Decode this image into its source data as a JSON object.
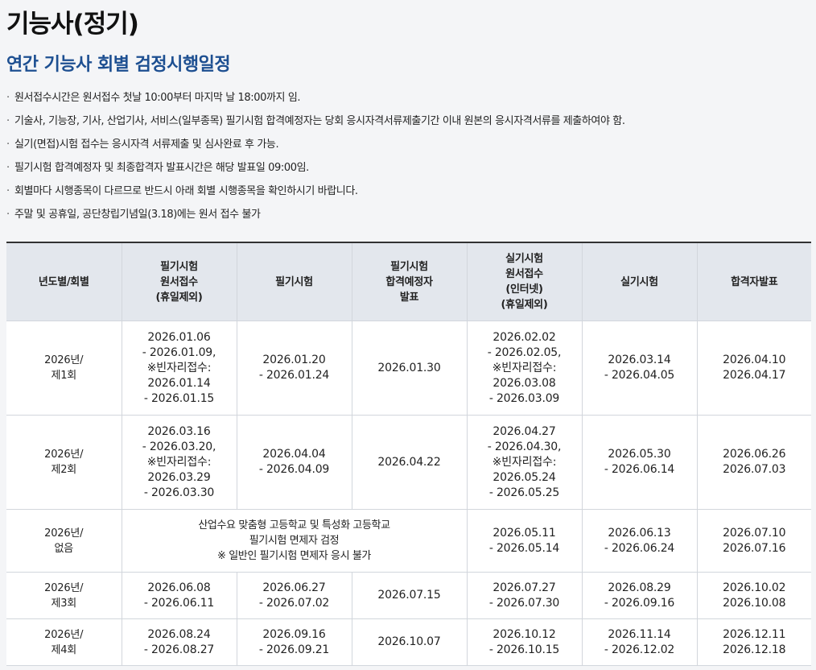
{
  "page": {
    "title": "기능사(정기)",
    "section_title": "연간 기능사 회별 검정시행일정"
  },
  "notices": [
    "원서접수시간은 원서접수 첫날 10:00부터 마지막 날 18:00까지 임.",
    "기술사, 기능장, 기사, 산업기사, 서비스(일부종목) 필기시험 합격예정자는 당회 응시자격서류제출기간 이내 원본의 응시자격서류를 제출하여야 함.",
    "실기(면접)시험 접수는 응시자격 서류제출 및 심사완료 후 가능.",
    "필기시험 합격예정자 및 최종합격자 발표시간은 해당 발표일 09:00임.",
    "회별마다 시행종목이 다르므로 반드시 아래 회별 시행종목을 확인하시기 바랍니다.",
    "주말 및 공휴일, 공단창립기념일(3.18)에는 원서 접수 불가"
  ],
  "bullet": "·",
  "table": {
    "headers": [
      "년도별/회별",
      "필기시험\n원서접수\n(휴일제외)",
      "필기시험",
      "필기시험\n합격예정자\n발표",
      "실기시험\n원서접수\n(인터넷)\n(휴일제외)",
      "실기시험",
      "합격자발표"
    ],
    "rows": [
      {
        "round": "2026년/\n제1회",
        "written_apply": "2026.01.06\n- 2026.01.09,\n※빈자리접수:\n2026.01.14\n- 2026.01.15",
        "written_exam": "2026.01.20\n- 2026.01.24",
        "written_result": "2026.01.30",
        "practical_apply": "2026.02.02\n- 2026.02.05,\n※빈자리접수:\n2026.03.08\n- 2026.03.09",
        "practical_exam": "2026.03.14\n- 2026.04.05",
        "final_result": "2026.04.10\n2026.04.17"
      },
      {
        "round": "2026년/\n제2회",
        "written_apply": "2026.03.16\n- 2026.03.20,\n※빈자리접수:\n2026.03.29\n- 2026.03.30",
        "written_exam": "2026.04.04\n- 2026.04.09",
        "written_result": "2026.04.22",
        "practical_apply": "2026.04.27\n- 2026.04.30,\n※빈자리접수:\n2026.05.24\n- 2026.05.25",
        "practical_exam": "2026.05.30\n- 2026.06.14",
        "final_result": "2026.06.26\n2026.07.03"
      },
      {
        "round": "2026년/\n없음",
        "note": "산업수요 맞춤형 고등학교 및 특성화 고등학교\n필기시험 면제자 검정\n※ 일반인 필기시험 면제자 응시 불가",
        "practical_apply": "2026.05.11\n- 2026.05.14",
        "practical_exam": "2026.06.13\n- 2026.06.24",
        "final_result": "2026.07.10\n2026.07.16"
      },
      {
        "round": "2026년/\n제3회",
        "written_apply": "2026.06.08\n- 2026.06.11",
        "written_exam": "2026.06.27\n- 2026.07.02",
        "written_result": "2026.07.15",
        "practical_apply": "2026.07.27\n- 2026.07.30",
        "practical_exam": "2026.08.29\n- 2026.09.16",
        "final_result": "2026.10.02\n2026.10.08"
      },
      {
        "round": "2026년/\n제4회",
        "written_apply": "2026.08.24\n- 2026.08.27",
        "written_exam": "2026.09.16\n- 2026.09.21",
        "written_result": "2026.10.07",
        "practical_apply": "2026.10.12\n- 2026.10.15",
        "practical_exam": "2026.11.14\n- 2026.12.02",
        "final_result": "2026.12.11\n2026.12.18"
      }
    ]
  }
}
